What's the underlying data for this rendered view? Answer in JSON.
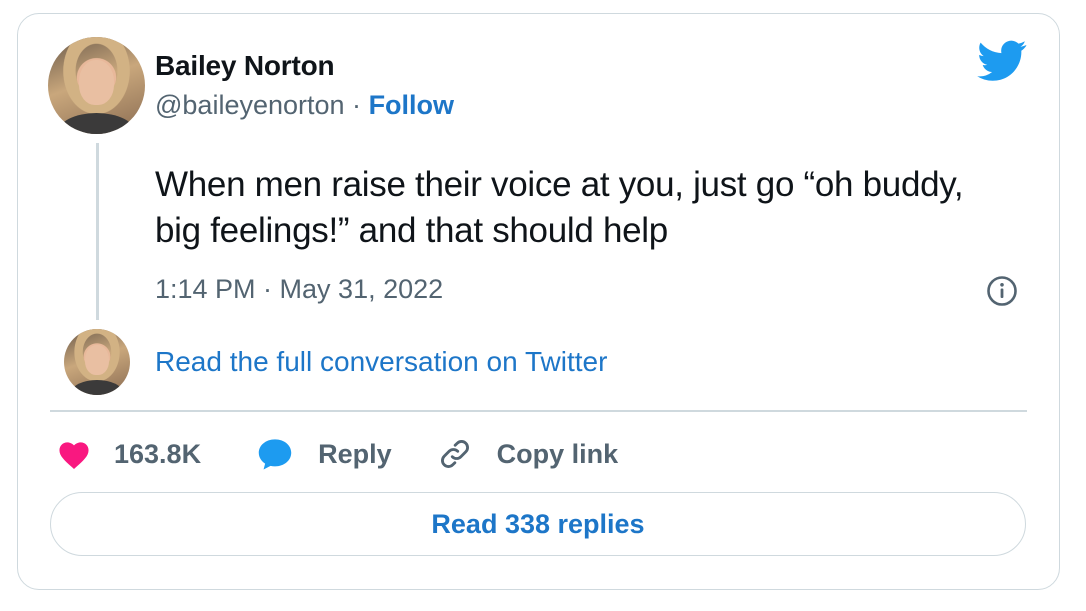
{
  "author": {
    "name": "Bailey Norton",
    "handle": "@baileyenorton",
    "separator": "·",
    "follow_label": "Follow"
  },
  "tweet": {
    "text": "When men raise their voice at you, just go “oh buddy, big feelings!” and that should help",
    "timestamp": "1:14 PM · May 31, 2022"
  },
  "conversation": {
    "label": "Read the full conversation on Twitter"
  },
  "actions": {
    "like_count": "163.8K",
    "reply_label": "Reply",
    "copy_link_label": "Copy link"
  },
  "replies_button": {
    "label": "Read 338 replies"
  },
  "colors": {
    "brand_blue": "#1d9bf0",
    "link_blue": "#1d76c8",
    "like_pink": "#f91880",
    "secondary_text": "#536471",
    "border": "#cfd9de"
  },
  "icons": {
    "logo": "twitter-bird-icon",
    "info": "info-icon",
    "like": "heart-icon",
    "reply": "speech-bubble-icon",
    "copy_link": "link-icon"
  }
}
